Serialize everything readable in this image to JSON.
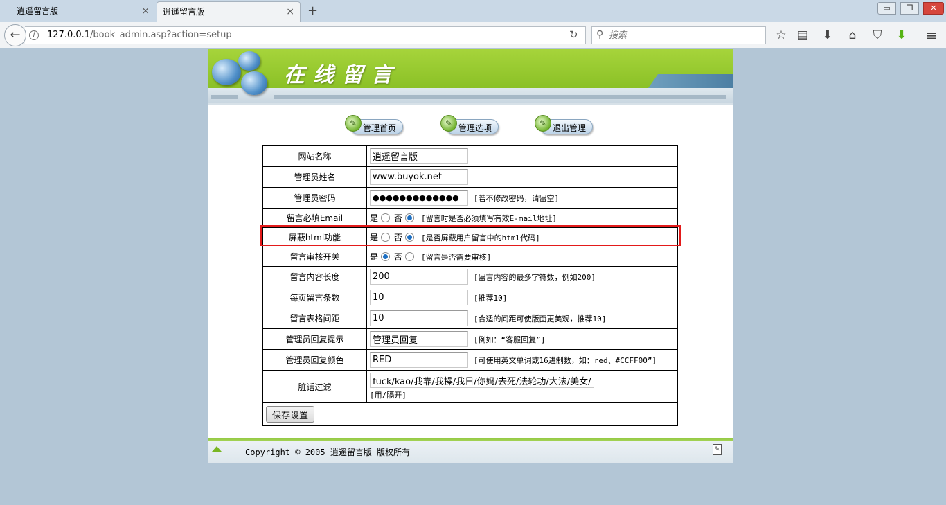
{
  "browser": {
    "tabs": [
      {
        "label": "逍遥留言版",
        "close": "×"
      },
      {
        "label": "逍遥留言版",
        "close": "×"
      }
    ],
    "new_tab": "+",
    "window": {
      "minimize": "▭",
      "maximize": "❐",
      "close": "✕"
    },
    "url_host": "127.0.0.1",
    "url_path": "/book_admin.asp?action=setup",
    "search_placeholder": "搜索"
  },
  "banner": {
    "title": "在线留言"
  },
  "admin_nav": [
    {
      "label": "管理首页"
    },
    {
      "label": "管理选项"
    },
    {
      "label": "退出管理"
    }
  ],
  "settings": {
    "site_name": {
      "label": "网站名称",
      "value": "逍遥留言版"
    },
    "admin_name": {
      "label": "管理员姓名",
      "value": "www.buyok.net"
    },
    "admin_password": {
      "label": "管理员密码",
      "value": "●●●●●●●●●●●●●",
      "hint": "[若不修改密码，请留空]"
    },
    "require_email": {
      "label": "留言必填Email",
      "yes": "是",
      "no": "否",
      "selected": "no",
      "hint": "[留言时是否必须填写有效E-mail地址]"
    },
    "block_html": {
      "label": "屏蔽html功能",
      "yes": "是",
      "no": "否",
      "selected": "no",
      "hint": "[是否屏蔽用户留言中的html代码]"
    },
    "review_switch": {
      "label": "留言审核开关",
      "yes": "是",
      "no": "否",
      "selected": "yes",
      "hint": "[留言是否需要审核]"
    },
    "content_length": {
      "label": "留言内容长度",
      "value": "200",
      "hint": "[留言内容的最多字符数，例如200]"
    },
    "per_page": {
      "label": "每页留言条数",
      "value": "10",
      "hint": "[推荐10]"
    },
    "table_spacing": {
      "label": "留言表格间距",
      "value": "10",
      "hint": "[合适的间距可使版面更美观，推荐10]"
    },
    "reply_prompt": {
      "label": "管理员回复提示",
      "value": "管理员回复",
      "hint": "[例如：“客服回复”]"
    },
    "reply_color": {
      "label": "管理员回复颜色",
      "value": "RED",
      "hint": "[可使用英文单词或16进制数，如：red、#CCFF00”]"
    },
    "word_filter": {
      "label": "脏话过滤",
      "value": "fuck/kao/我靠/我操/我日/你妈/去死/法轮功/大法/美女/",
      "hint": "[用/隔开]"
    },
    "save_label": "保存设置"
  },
  "footer": {
    "text": "Copyright © 2005 逍遥留言版 版权所有"
  },
  "colors": {
    "highlight": "#e31a1a",
    "banner_green": "#8ec63f"
  }
}
